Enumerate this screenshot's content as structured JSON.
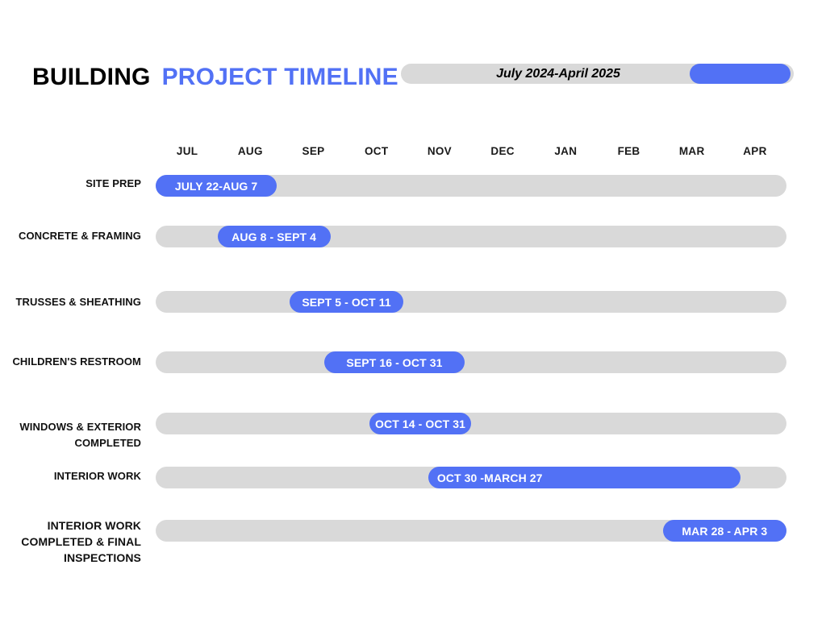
{
  "header": {
    "title_primary": "BUILDING",
    "title_secondary": "PROJECT TIMELINE",
    "date_range": "July 2024-April 2025"
  },
  "colors": {
    "accent_blue": "#5271F5",
    "track_gray": "#D9D9D9",
    "text_dark": "#000000",
    "bar_text": "#FFFFFF"
  },
  "chart_data": {
    "type": "bar",
    "title": "BUILDING PROJECT TIMELINE",
    "subtitle": "July 2024-April 2025",
    "orientation": "horizontal",
    "xlabel": "",
    "ylabel": "",
    "grid": false,
    "legend": "none",
    "axis_ticks": [
      "JUL",
      "AUG",
      "SEP",
      "OCT",
      "NOV",
      "DEC",
      "JAN",
      "FEB",
      "MAR",
      "APR"
    ],
    "axis_range": [
      "JUL 2024",
      "APR 2025"
    ],
    "categories": [
      "SITE PREP",
      "CONCRETE & FRAMING",
      "TRUSSES & SHEATHING",
      "CHILDREN'S RESTROOM",
      "WINDOWS & EXTERIOR COMPLETED",
      "INTERIOR WORK",
      "INTERIOR WORK COMPLETED & FINAL INSPECTIONS"
    ],
    "tasks": [
      {
        "label": "SITE PREP",
        "label_lines": [
          "SITE PREP"
        ],
        "range": "JULY 22-AUG 7",
        "start_pct": 0.0,
        "end_pct": 19.2,
        "align": "center"
      },
      {
        "label": "CONCRETE & FRAMING",
        "label_lines": [
          "CONCRETE & FRAMING"
        ],
        "range": "AUG 8 - SEPT 4",
        "start_pct": 9.8,
        "end_pct": 27.7,
        "align": "center"
      },
      {
        "label": "TRUSSES & SHEATHING",
        "label_lines": [
          "TRUSSES & SHEATHING"
        ],
        "range": "SEPT 5 - OCT 11",
        "start_pct": 21.2,
        "end_pct": 39.3,
        "align": "center"
      },
      {
        "label": "CHILDREN'S RESTROOM",
        "label_lines": [
          "CHILDREN'S RESTROOM"
        ],
        "range": "SEPT 16 - OCT 31",
        "start_pct": 26.7,
        "end_pct": 49.0,
        "align": "center"
      },
      {
        "label": "WINDOWS & EXTERIOR COMPLETED",
        "label_lines": [
          "WINDOWS & EXTERIOR",
          "COMPLETED"
        ],
        "range": "OCT 14 - OCT 31",
        "start_pct": 33.9,
        "end_pct": 50.0,
        "align": "center"
      },
      {
        "label": "INTERIOR WORK",
        "label_lines": [
          "INTERIOR WORK"
        ],
        "range": "OCT 30 -MARCH 27",
        "start_pct": 43.2,
        "end_pct": 92.7,
        "align": "left"
      },
      {
        "label": "INTERIOR WORK COMPLETED & FINAL INSPECTIONS",
        "label_lines": [
          "INTERIOR WORK",
          "COMPLETED & FINAL",
          "INSPECTIONS"
        ],
        "range": "MAR 28 - APR 3",
        "start_pct": 80.4,
        "end_pct": 100.0,
        "align": "center"
      }
    ]
  }
}
